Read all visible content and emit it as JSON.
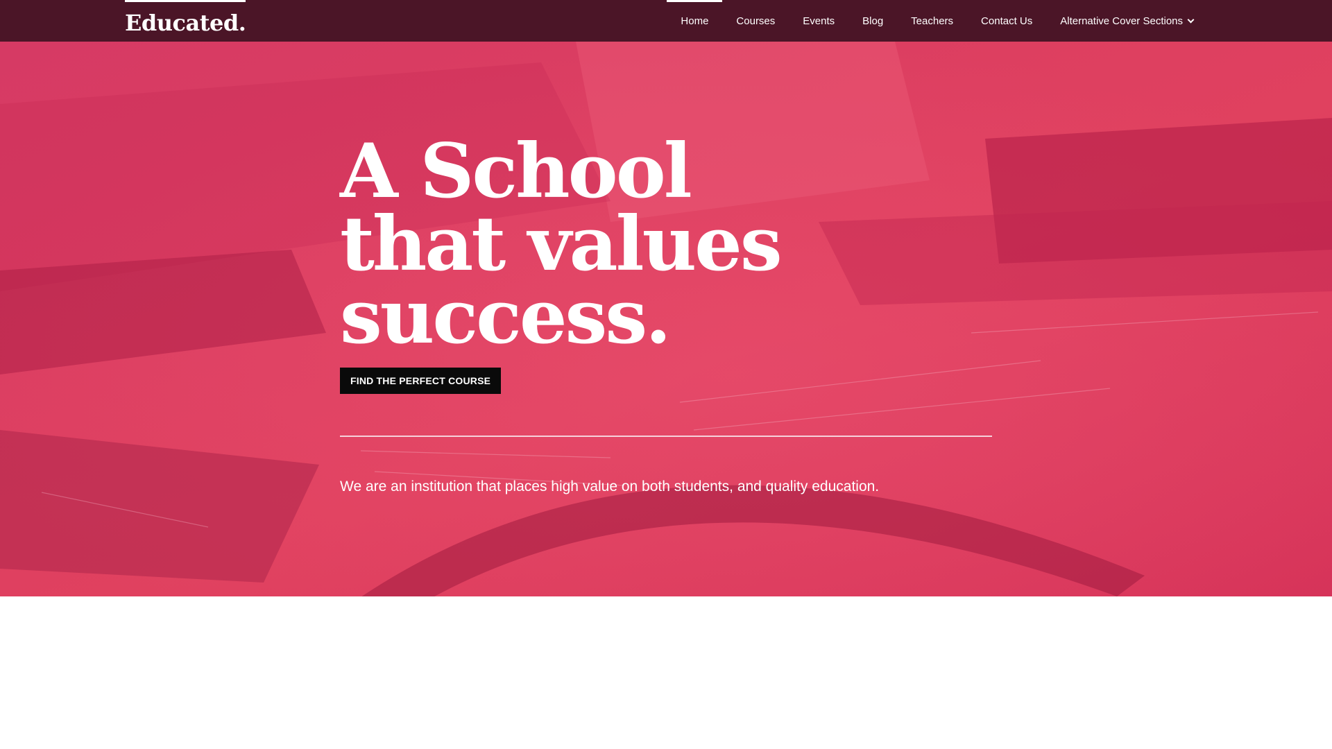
{
  "site": {
    "logo": "Educated."
  },
  "nav": {
    "items": [
      {
        "label": "Home",
        "active": true
      },
      {
        "label": "Courses",
        "active": false
      },
      {
        "label": "Events",
        "active": false
      },
      {
        "label": "Blog",
        "active": false
      },
      {
        "label": "Teachers",
        "active": false
      },
      {
        "label": "Contact Us",
        "active": false
      },
      {
        "label": "Alternative Cover Sections",
        "active": false,
        "has_dropdown": true,
        "icon": "chevron-down-icon"
      }
    ]
  },
  "hero": {
    "title_lines": [
      "A School",
      "that values",
      "success."
    ],
    "cta_label": "FIND THE PERFECT COURSE",
    "tagline": "We are an institution that places high value on both students, and quality education."
  },
  "colors": {
    "nav_bg": "#4b1527",
    "hero_overlay": "#d8335e",
    "cta_bg": "#0a0a0a",
    "text": "#ffffff"
  }
}
